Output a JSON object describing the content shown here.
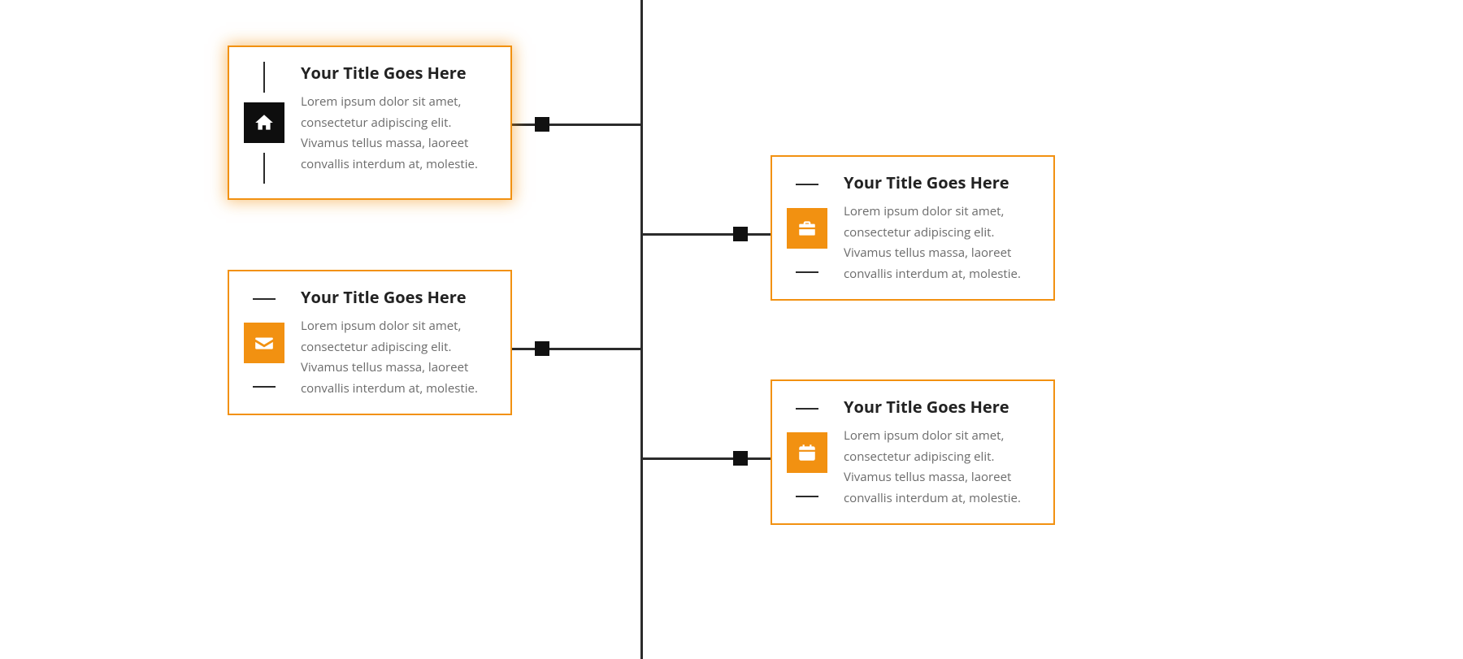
{
  "colors": {
    "accent": "#f29111",
    "dark": "#1a1a1a",
    "heading": "#222222",
    "body_text": "#6b6b6b"
  },
  "timeline": {
    "items": [
      {
        "side": "left",
        "icon": "home-icon",
        "icon_bg": "dark",
        "tick_style": "vertical",
        "highlighted": true,
        "title": "Your Title Goes Here",
        "text": "Lorem ipsum dolor sit amet, consectetur adipiscing elit. Vivamus tellus massa, laoreet convallis interdum at, molestie."
      },
      {
        "side": "right",
        "icon": "briefcase-icon",
        "icon_bg": "orange",
        "tick_style": "horizontal",
        "highlighted": false,
        "title": "Your Title Goes Here",
        "text": "Lorem ipsum dolor sit amet, consectetur adipiscing elit. Vivamus tellus massa, laoreet convallis interdum at, molestie."
      },
      {
        "side": "left",
        "icon": "envelope-icon",
        "icon_bg": "orange",
        "tick_style": "horizontal",
        "highlighted": false,
        "title": "Your Title Goes Here",
        "text": "Lorem ipsum dolor sit amet, consectetur adipiscing elit. Vivamus tellus massa, laoreet convallis interdum at, molestie."
      },
      {
        "side": "right",
        "icon": "calendar-icon",
        "icon_bg": "orange",
        "tick_style": "horizontal",
        "highlighted": false,
        "title": "Your Title Goes Here",
        "text": "Lorem ipsum dolor sit amet, consectetur adipiscing elit. Vivamus tellus massa, laoreet convallis interdum at, molestie."
      }
    ]
  }
}
